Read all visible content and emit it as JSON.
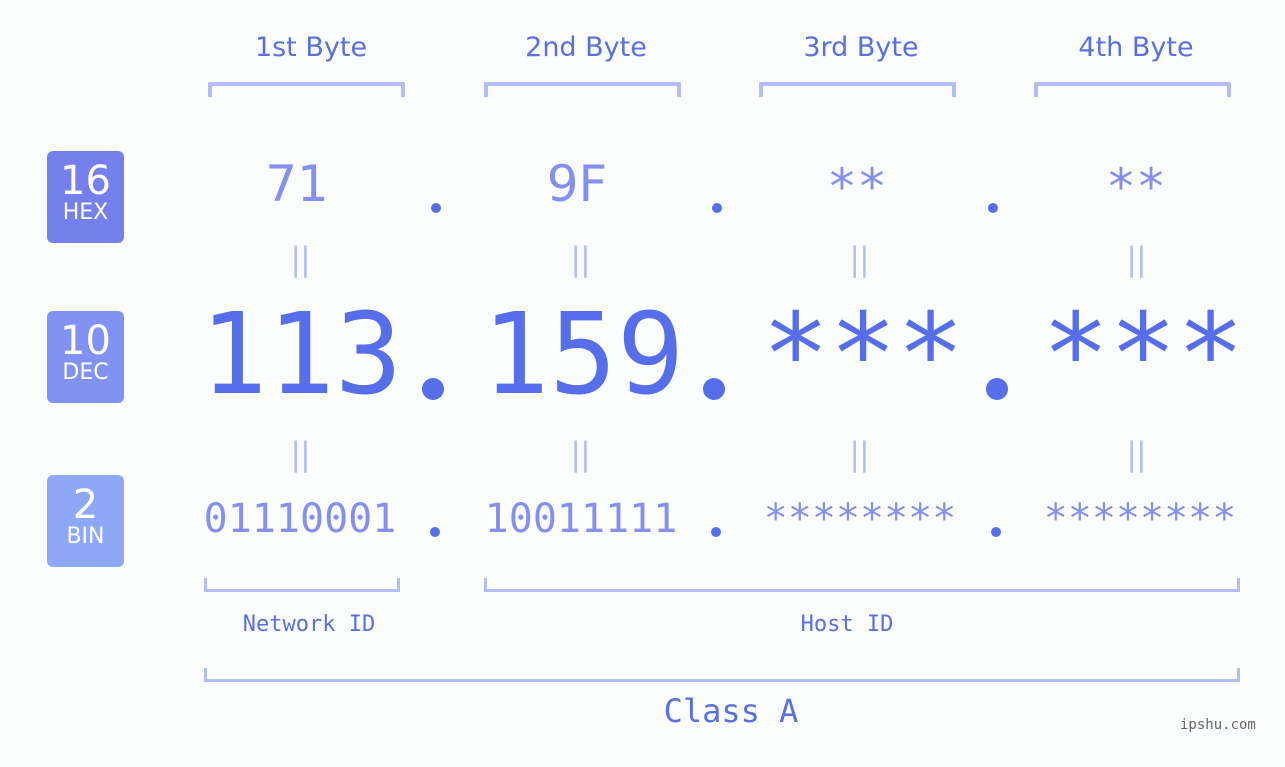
{
  "colors": {
    "background": "#fbfdfc",
    "accent": "#566eea",
    "light_text": "#8590ee",
    "bracket": "#b4bcf6",
    "badge_hex": "#7580ec",
    "badge_dec": "#8292f2",
    "badge_bin": "#8ea8f8"
  },
  "headers": [
    "1st Byte",
    "2nd Byte",
    "3rd Byte",
    "4th Byte"
  ],
  "badges": {
    "hex": {
      "base": "16",
      "label": "HEX"
    },
    "dec": {
      "base": "10",
      "label": "DEC"
    },
    "bin": {
      "base": "2",
      "label": "BIN"
    }
  },
  "hex": [
    "71",
    "9F",
    "**",
    "**"
  ],
  "dec": [
    "113",
    "159",
    "***",
    "***"
  ],
  "bin": [
    "01110001",
    "10011111",
    "********",
    "********"
  ],
  "separator": ".",
  "equals": "||",
  "labels": {
    "network_id": "Network ID",
    "host_id": "Host ID",
    "class": "Class A"
  },
  "watermark": "ipshu.com"
}
